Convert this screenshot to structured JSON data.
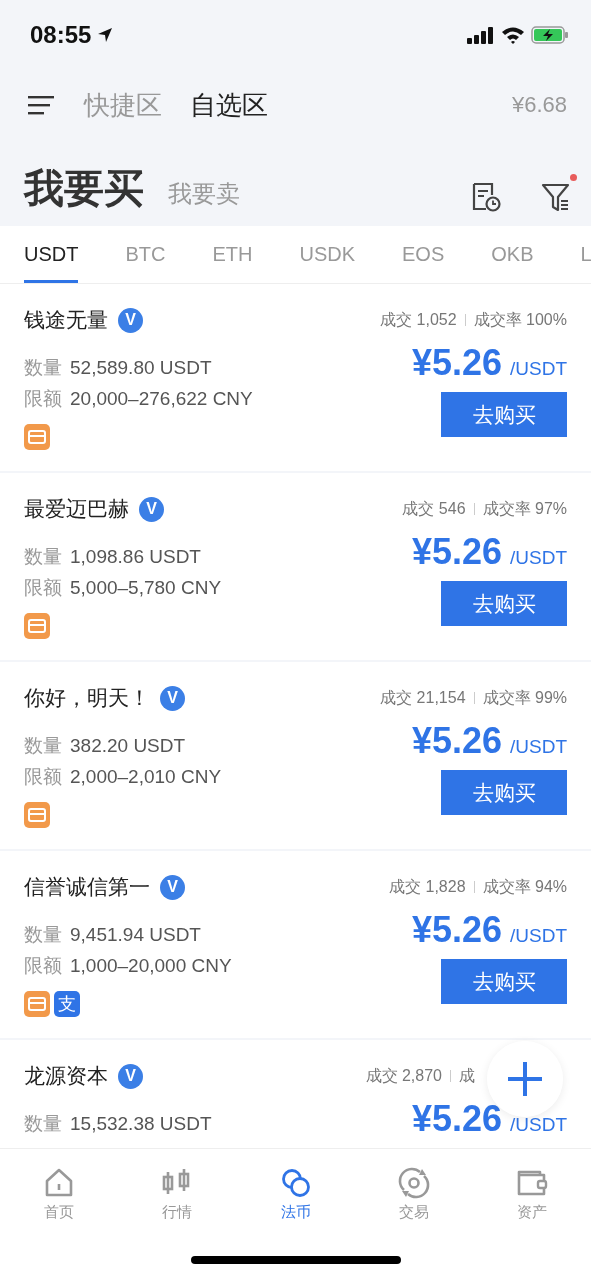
{
  "status_bar": {
    "time": "08:55"
  },
  "header": {
    "zones": [
      {
        "label": "快捷区",
        "selected": false
      },
      {
        "label": "自选区",
        "selected": true
      }
    ],
    "rate": "¥6.68"
  },
  "sides": [
    {
      "label": "我要买",
      "selected": true
    },
    {
      "label": "我要卖",
      "selected": false
    }
  ],
  "filter": {
    "has_dot": true
  },
  "tabs": [
    {
      "label": "USDT",
      "selected": true
    },
    {
      "label": "BTC",
      "selected": false
    },
    {
      "label": "ETH",
      "selected": false
    },
    {
      "label": "USDK",
      "selected": false
    },
    {
      "label": "EOS",
      "selected": false
    },
    {
      "label": "OKB",
      "selected": false
    },
    {
      "label": "L",
      "selected": false
    }
  ],
  "ads": [
    {
      "name": "钱途无量",
      "verified": true,
      "verified_mark": "V",
      "trades": "成交 1,052",
      "rate": "成交率 100%",
      "amount_label": "数量",
      "amount": "52,589.80 USDT",
      "limit_label": "限额",
      "limit": "20,000–276,622 CNY",
      "price": "¥5.26",
      "unit": "/USDT",
      "button": "去购买",
      "payments": [
        {
          "kind": "bank"
        }
      ]
    },
    {
      "name": "最爱迈巴赫",
      "verified": true,
      "verified_mark": "V",
      "trades": "成交 546",
      "rate": "成交率 97%",
      "amount_label": "数量",
      "amount": "1,098.86 USDT",
      "limit_label": "限额",
      "limit": "5,000–5,780 CNY",
      "price": "¥5.26",
      "unit": "/USDT",
      "button": "去购买",
      "payments": [
        {
          "kind": "bank"
        }
      ]
    },
    {
      "name": "你好，明天！",
      "verified": true,
      "verified_mark": "V",
      "trades": "成交 21,154",
      "rate": "成交率 99%",
      "amount_label": "数量",
      "amount": "382.20 USDT",
      "limit_label": "限额",
      "limit": "2,000–2,010 CNY",
      "price": "¥5.26",
      "unit": "/USDT",
      "button": "去购买",
      "payments": [
        {
          "kind": "bank"
        }
      ]
    },
    {
      "name": "信誉诚信第一",
      "verified": true,
      "verified_mark": "V",
      "trades": "成交 1,828",
      "rate": "成交率 94%",
      "amount_label": "数量",
      "amount": "9,451.94 USDT",
      "limit_label": "限额",
      "limit": "1,000–20,000 CNY",
      "price": "¥5.26",
      "unit": "/USDT",
      "button": "去购买",
      "payments": [
        {
          "kind": "bank"
        },
        {
          "kind": "alipay",
          "glyph": "支"
        }
      ]
    },
    {
      "name": "龙源资本",
      "verified": true,
      "verified_mark": "V",
      "trades": "成交 2,870",
      "rate": "成",
      "amount_label": "数量",
      "amount": "15,532.38 USDT",
      "price": "¥5.26",
      "unit": "/USDT"
    }
  ],
  "nav": [
    {
      "label": "首页",
      "kind": "home",
      "selected": false
    },
    {
      "label": "行情",
      "kind": "market",
      "selected": false
    },
    {
      "label": "法币",
      "kind": "fiat",
      "selected": true
    },
    {
      "label": "交易",
      "kind": "trade",
      "selected": false
    },
    {
      "label": "资产",
      "kind": "assets",
      "selected": false
    }
  ]
}
